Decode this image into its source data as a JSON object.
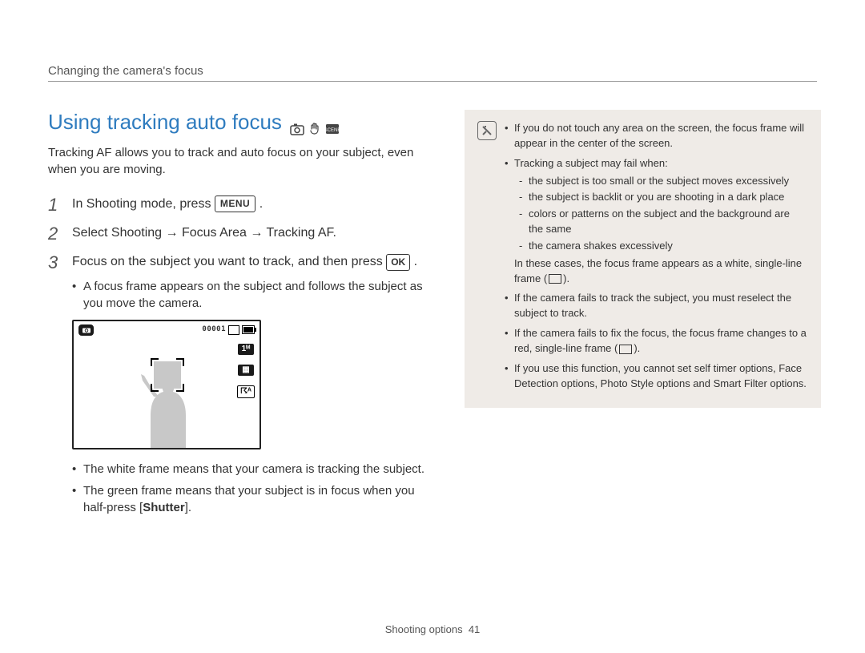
{
  "header": {
    "breadcrumb": "Changing the camera's focus"
  },
  "section": {
    "title": "Using tracking auto focus",
    "intro": "Tracking AF allows you to track and auto focus on your subject, even when you are moving."
  },
  "steps": {
    "s1_num": "1",
    "s1_a": "In Shooting mode, press ",
    "s1_menu": "MENU",
    "s1_b": ".",
    "s2_num": "2",
    "s2": "Select Shooting → Focus Area → Tracking AF.",
    "s3_num": "3",
    "s3_a": "Focus on the subject you want to track, and then press ",
    "s3_ok": "OK",
    "s3_b": "."
  },
  "sub_bullets": {
    "b1": "A focus frame appears on the subject and follows the subject as you move the camera.",
    "b2": "The white frame means that your camera is tracking the subject.",
    "b3_a": "The green frame means that your subject is in focus when you half-press [",
    "b3_bold": "Shutter",
    "b3_b": "]."
  },
  "screen": {
    "counter": "00001",
    "side1": "1ᴹ",
    "side2": "▦",
    "side3": "☈ᴬ"
  },
  "notes": {
    "n1": "If you do not touch any area on the screen, the focus frame will appear in the center of the screen.",
    "n2": "Tracking a subject may fail when:",
    "d1": "the subject is too small or the subject moves excessively",
    "d2": "the subject is backlit or you are shooting in a dark place",
    "d3": "colors or patterns on the subject and the background are the same",
    "d4": "the camera shakes excessively",
    "n2b_a": "In these cases, the focus frame appears as a white, single-line frame (",
    "n2b_b": ").",
    "n3": "If the camera fails to track the subject, you must reselect the subject to track.",
    "n4_a": "If the camera fails to fix the focus, the focus frame changes to a red, single-line frame (",
    "n4_b": ").",
    "n5": "If you use this function, you cannot set self timer options, Face Detection options, Photo Style options and Smart Filter options."
  },
  "footer": {
    "section": "Shooting options",
    "page": "41"
  }
}
